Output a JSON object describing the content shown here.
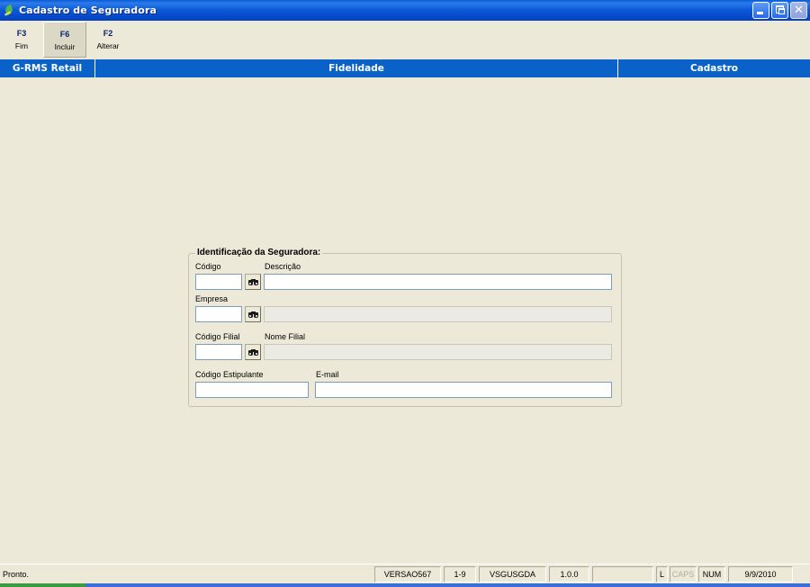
{
  "window": {
    "title": "Cadastro de Seguradora"
  },
  "toolbar": {
    "items": [
      {
        "key": "F3",
        "label": "Fim"
      },
      {
        "key": "F6",
        "label": "Incluir"
      },
      {
        "key": "F2",
        "label": "Alterar"
      }
    ]
  },
  "band": {
    "product": "G-RMS Retail",
    "module": "Fidelidade",
    "screen": "Cadastro"
  },
  "form": {
    "group_title": "Identificação da Seguradora:",
    "codigo_label": "Código",
    "codigo_value": "",
    "descricao_label": "Descrição",
    "descricao_value": "",
    "empresa_label": "Empresa",
    "empresa_value": "",
    "empresa_nome_value": "",
    "codigo_filial_label": "Código Filial",
    "codigo_filial_value": "",
    "nome_filial_label": "Nome Filial",
    "nome_filial_value": "",
    "codigo_estipulante_label": "Código Estipulante",
    "codigo_estipulante_value": "",
    "email_label": "E-mail",
    "email_value": ""
  },
  "statusbar": {
    "message": "Pronto.",
    "panels": [
      "VERSAO567",
      "1-9",
      "VSGUSGDA",
      "1.0.0",
      "",
      "L",
      "CAPS",
      "NUM",
      "9/9/2010"
    ]
  },
  "icons": {
    "search": "binoculars-icon",
    "app": "leaf-app-icon"
  },
  "colors": {
    "titlebar": "#0a5ad6",
    "band": "#0a62c8",
    "background": "#ece9d8"
  }
}
